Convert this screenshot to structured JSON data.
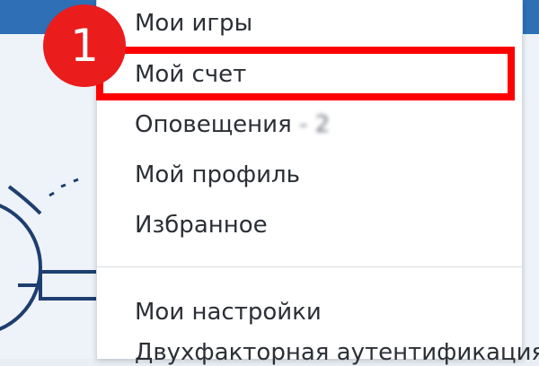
{
  "menu": {
    "items": [
      {
        "label": "Мои игры"
      },
      {
        "label": "Мой счет"
      },
      {
        "label": "Оповещения",
        "blurred_suffix": " - 2"
      },
      {
        "label": "Мой профиль"
      },
      {
        "label": "Избранное"
      },
      {
        "label": "Мои настройки"
      }
    ],
    "cutoff_item": "Двухфакторная аутентификация"
  },
  "callout": {
    "number": "1",
    "color": "#ea1c1c"
  },
  "highlight": {
    "color": "#ff0000"
  },
  "colors": {
    "topbar": "#2e6fb6",
    "menu_bg": "#ffffff",
    "text": "#2b2f36"
  }
}
